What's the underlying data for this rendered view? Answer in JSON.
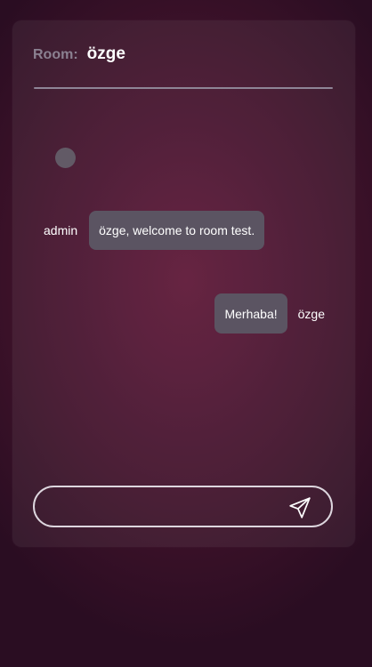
{
  "header": {
    "room_label": "Room:",
    "room_name": "özge"
  },
  "messages": [
    {
      "sender": "admin",
      "text": "özge, welcome to room test.",
      "direction": "incoming"
    },
    {
      "sender": "özge",
      "text": "Merhaba!",
      "direction": "outgoing"
    }
  ],
  "composer": {
    "placeholder": "",
    "value": "",
    "send_icon": "send-icon"
  },
  "colors": {
    "background": "#4c1430",
    "bubble": "#5b5462",
    "avatar": "#625a66",
    "input_border": "#ddd6de",
    "label_muted": "#8b8191"
  }
}
